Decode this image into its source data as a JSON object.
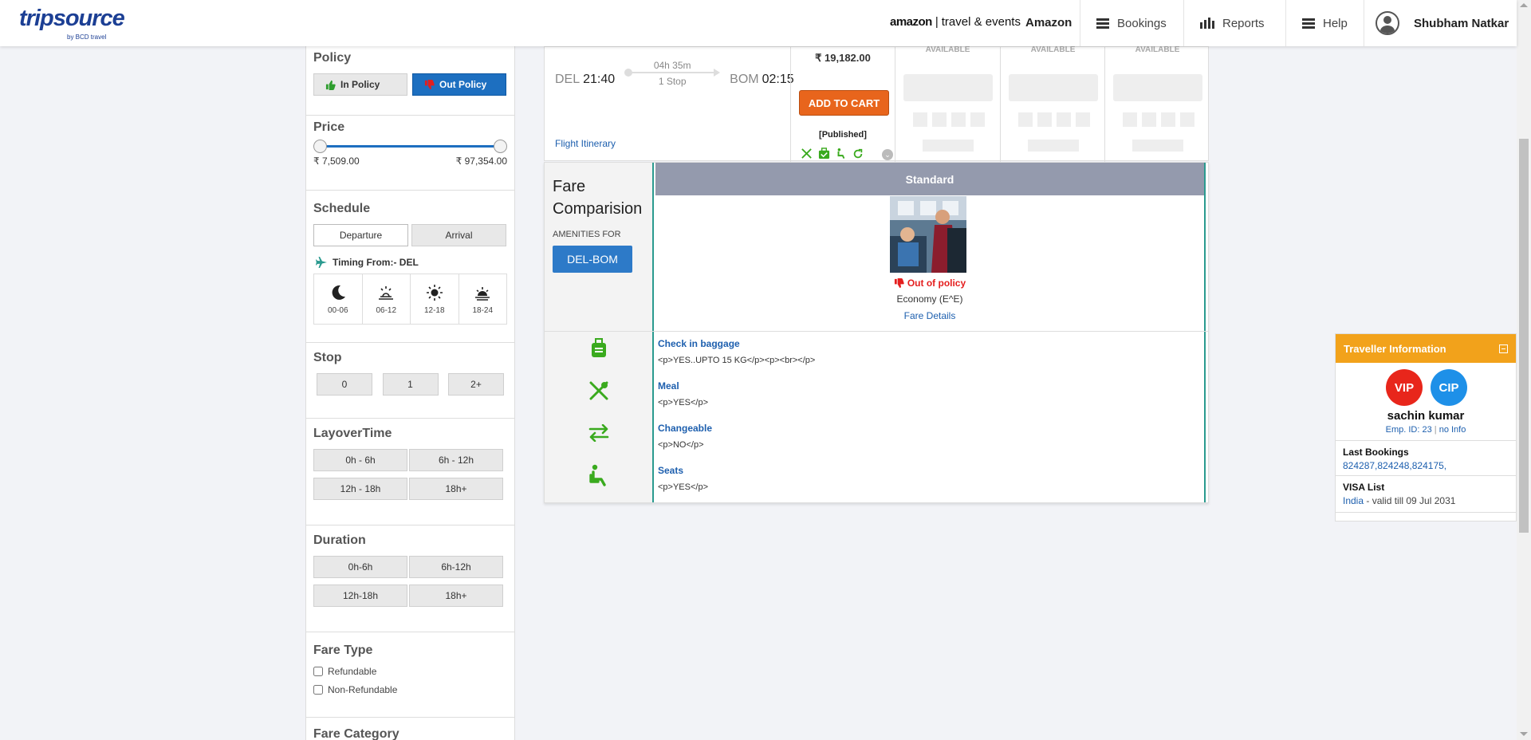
{
  "header": {
    "logo": "tripsource",
    "logo_sub": "by BCD travel",
    "brand_amazon": "amazon",
    "brand_rest": "travel & events",
    "company": "Amazon",
    "nav": [
      "Bookings",
      "Reports",
      "Help"
    ],
    "user": "Shubham Natkar"
  },
  "sidebar": {
    "policy": {
      "title": "Policy",
      "in": "In Policy",
      "out": "Out Policy"
    },
    "price": {
      "title": "Price",
      "min": "₹ 7,509.00",
      "max": "₹ 97,354.00"
    },
    "schedule": {
      "title": "Schedule",
      "departure": "Departure",
      "arrival": "Arrival",
      "timing": "Timing From:- DEL",
      "slots": [
        "00-06",
        "06-12",
        "12-18",
        "18-24"
      ]
    },
    "stop": {
      "title": "Stop",
      "options": [
        "0",
        "1",
        "2+"
      ]
    },
    "layover": {
      "title": "LayoverTime",
      "options": [
        "0h - 6h",
        "6h - 12h",
        "12h - 18h",
        "18h+"
      ]
    },
    "duration": {
      "title": "Duration",
      "options": [
        "0h-6h",
        "6h-12h",
        "12h-18h",
        "18h+"
      ]
    },
    "fare_type": {
      "title": "Fare Type",
      "options": [
        "Refundable",
        "Non-Refundable"
      ]
    },
    "fare_category": {
      "title": "Fare Category"
    }
  },
  "result": {
    "from_code": "DEL",
    "dep": "21:40",
    "duration": "04h 35m",
    "stops": "1 Stop",
    "to_code": "BOM",
    "arr": "02:15",
    "itinerary": "Flight Itinerary",
    "price": "₹ 19,182.00",
    "add_to_cart": "ADD TO CART",
    "published": "[Published]",
    "available": [
      "AVAILABLE",
      "AVAILABLE",
      "AVAILABLE"
    ]
  },
  "compare": {
    "title_1": "Fare",
    "title_2": "Comparision",
    "amenities_for": "AMENITIES FOR",
    "route": "DEL-BOM",
    "fare_name": "Standard",
    "policy_status": "Out of policy",
    "cabin": "Economy (E^E)",
    "fare_details": "Fare Details",
    "amenities": [
      {
        "name": "Check in baggage",
        "value": "<p>YES..UPTO 15 KG</p><p><br></p>"
      },
      {
        "name": "Meal",
        "value": "<p>YES</p>"
      },
      {
        "name": "Changeable",
        "value": "<p>NO</p>"
      },
      {
        "name": "Seats",
        "value": "<p>YES</p>"
      }
    ]
  },
  "traveller": {
    "title": "Traveller Information",
    "badges": [
      "VIP",
      "CIP"
    ],
    "name": "sachin kumar",
    "emp_id": "Emp. ID: 23",
    "emp_info": "no Info",
    "last_bookings_title": "Last Bookings",
    "last_bookings": "824287,824248,824175,",
    "visa_title": "VISA List",
    "visa_country": "India",
    "visa_validity": " - valid till 09 Jul 2031"
  },
  "colors": {
    "accent": "#1d6fc0",
    "cart": "#e8651c",
    "teal": "#2a9a8f",
    "panel_head": "#f2a21b",
    "vip": "#e8261b",
    "cip": "#1e90e8",
    "green": "#3aaa1e"
  }
}
